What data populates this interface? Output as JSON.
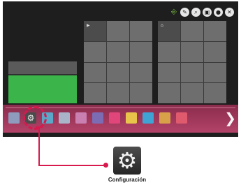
{
  "top_bar": {
    "icons": [
      {
        "name": "input-icon",
        "glyph": "⎆"
      },
      {
        "name": "edit-icon",
        "glyph": "✎"
      },
      {
        "name": "search-icon",
        "glyph": "⌕"
      },
      {
        "name": "apps-icon",
        "glyph": "▣"
      },
      {
        "name": "account-icon",
        "glyph": "●"
      },
      {
        "name": "close-icon",
        "glyph": "✕"
      }
    ]
  },
  "cards": {
    "a_label": "▶",
    "b_label": "⌂"
  },
  "launcher": {
    "tiles": [
      {
        "name": "app-tile-1",
        "color": "#8e9bbd"
      },
      {
        "name": "app-tile-settings",
        "glyph": "⚙"
      },
      {
        "name": "app-tile-3",
        "color": "#5aa7c7"
      },
      {
        "name": "app-tile-4",
        "color": "#a9b4c8"
      },
      {
        "name": "app-tile-5",
        "color": "#c97fb0"
      },
      {
        "name": "app-tile-6",
        "color": "#7b6cb4"
      },
      {
        "name": "app-tile-7",
        "color": "#e0467a"
      },
      {
        "name": "app-tile-8",
        "color": "#e8c44a"
      },
      {
        "name": "app-tile-9",
        "color": "#3fa3d4"
      },
      {
        "name": "app-tile-10",
        "color": "#d9a04a"
      },
      {
        "name": "app-tile-11",
        "color": "#e05a6e"
      }
    ],
    "next_glyph": "❯"
  },
  "callout": {
    "icon_glyph": "⚙",
    "label": "Configuración",
    "accent_color": "#d7194d"
  }
}
